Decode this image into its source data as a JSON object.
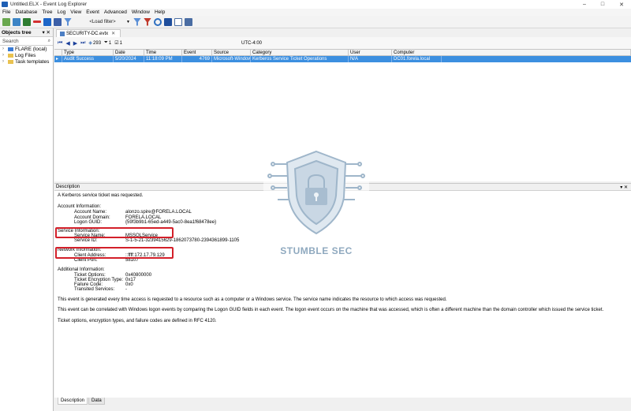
{
  "window": {
    "title": "Untitled.ELX - Event Log Explorer",
    "minimize": "–",
    "maximize": "□",
    "close": "✕"
  },
  "menu": [
    "File",
    "Database",
    "Tree",
    "Log",
    "View",
    "Event",
    "Advanced",
    "Window",
    "Help"
  ],
  "toolbar": {
    "load_filter": "<Load filter>"
  },
  "objects_tree": {
    "title": "Objects tree",
    "pin": "▾ ✕",
    "search_placeholder": "Search",
    "items": [
      {
        "label": "FLARE (local)",
        "icon": "computer-icon"
      },
      {
        "label": "Log Files",
        "icon": "folder-icon"
      },
      {
        "label": "Task templates",
        "icon": "folder-icon"
      }
    ]
  },
  "tab": {
    "label": "SECURITY-DC.evtx",
    "close": "✕"
  },
  "nav": {
    "total": "293",
    "filtered": "1",
    "checked": "1",
    "timezone": "UTC-4:00"
  },
  "grid": {
    "columns": [
      "Type",
      "Date",
      "Time",
      "Event",
      "Source",
      "Category",
      "User",
      "Computer"
    ],
    "rows": [
      {
        "type": "Audit Success",
        "date": "5/20/2024",
        "time": "11:18:09 PM",
        "event": "4769",
        "source": "Microsoft-Windows",
        "category": "Kerberos Service Ticket Operations",
        "user": "N/A",
        "computer": "DC01.forela.local"
      }
    ]
  },
  "watermark": {
    "text": "STUMBLE SEC"
  },
  "description": {
    "title": "Description",
    "pin": "▾ ✕",
    "intro": "A Kerberos service ticket was requested.",
    "account_header": "Account Information:",
    "account_name_label": "Account Name:",
    "account_name": "alonzo.spire@FORELA.LOCAL",
    "account_domain_label": "Account Domain:",
    "account_domain": "FORELA.LOCAL",
    "logon_guid_label": "Logon GUID:",
    "logon_guid": "{59f3b9b1-65ed-a449-5ac0-8ea1f68478ee}",
    "service_header": "Service Information:",
    "service_name_label": "Service Name:",
    "service_name": "MSSQLService",
    "service_id_label": "Service ID:",
    "service_id": "S-1-5-21-3239415629-1862073780-2394361899-1105",
    "network_header": "Network Information:",
    "client_address_label": "Client Address:",
    "client_address": "::ffff:172.17.79.129",
    "client_port_label": "Client Port:",
    "client_port": "58107",
    "additional_header": "Additional Information:",
    "ticket_options_label": "Ticket Options:",
    "ticket_options": "0x40800000",
    "ticket_enc_label": "Ticket Encryption Type:",
    "ticket_enc": "0x17",
    "failure_code_label": "Failure Code:",
    "failure_code": "0x0",
    "transited_label": "Transited Services:",
    "transited": "-",
    "para1": "This event is generated every time access is requested to a resource such as a computer or a Windows service.  The service name indicates the resource to which access was requested.",
    "para2": "This event can be correlated with Windows logon events by comparing the Logon GUID fields in each event.  The logon event occurs on the machine that was accessed, which is often a different machine than the domain controller which issued the service ticket.",
    "para3": "Ticket options, encryption types, and failure codes are defined in RFC 4120."
  },
  "bottom_tabs": [
    "Description",
    "Data"
  ],
  "colors": {
    "selection": "#3c8fe0",
    "highlight_box": "#d3202a"
  }
}
